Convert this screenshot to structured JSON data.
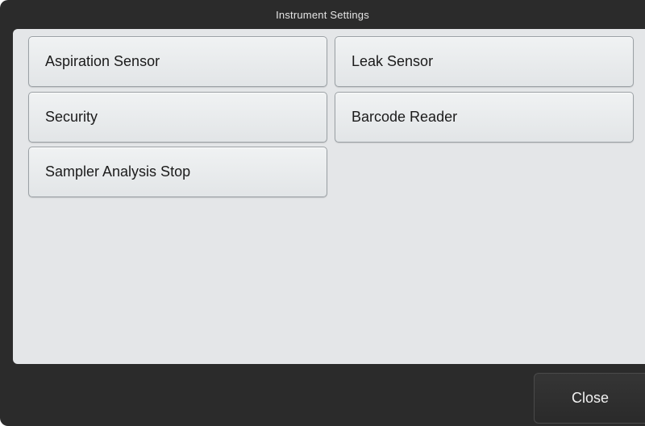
{
  "dialog": {
    "title": "Instrument Settings"
  },
  "settings": {
    "buttons": [
      {
        "label": "Aspiration Sensor"
      },
      {
        "label": "Leak Sensor"
      },
      {
        "label": "Security"
      },
      {
        "label": "Barcode Reader"
      },
      {
        "label": "Sampler Analysis Stop"
      }
    ]
  },
  "footer": {
    "close_label": "Close"
  },
  "colors": {
    "window_background": "#2b2b2b",
    "panel_background": "#e4e6e8",
    "button_border": "#9aa0a4"
  }
}
